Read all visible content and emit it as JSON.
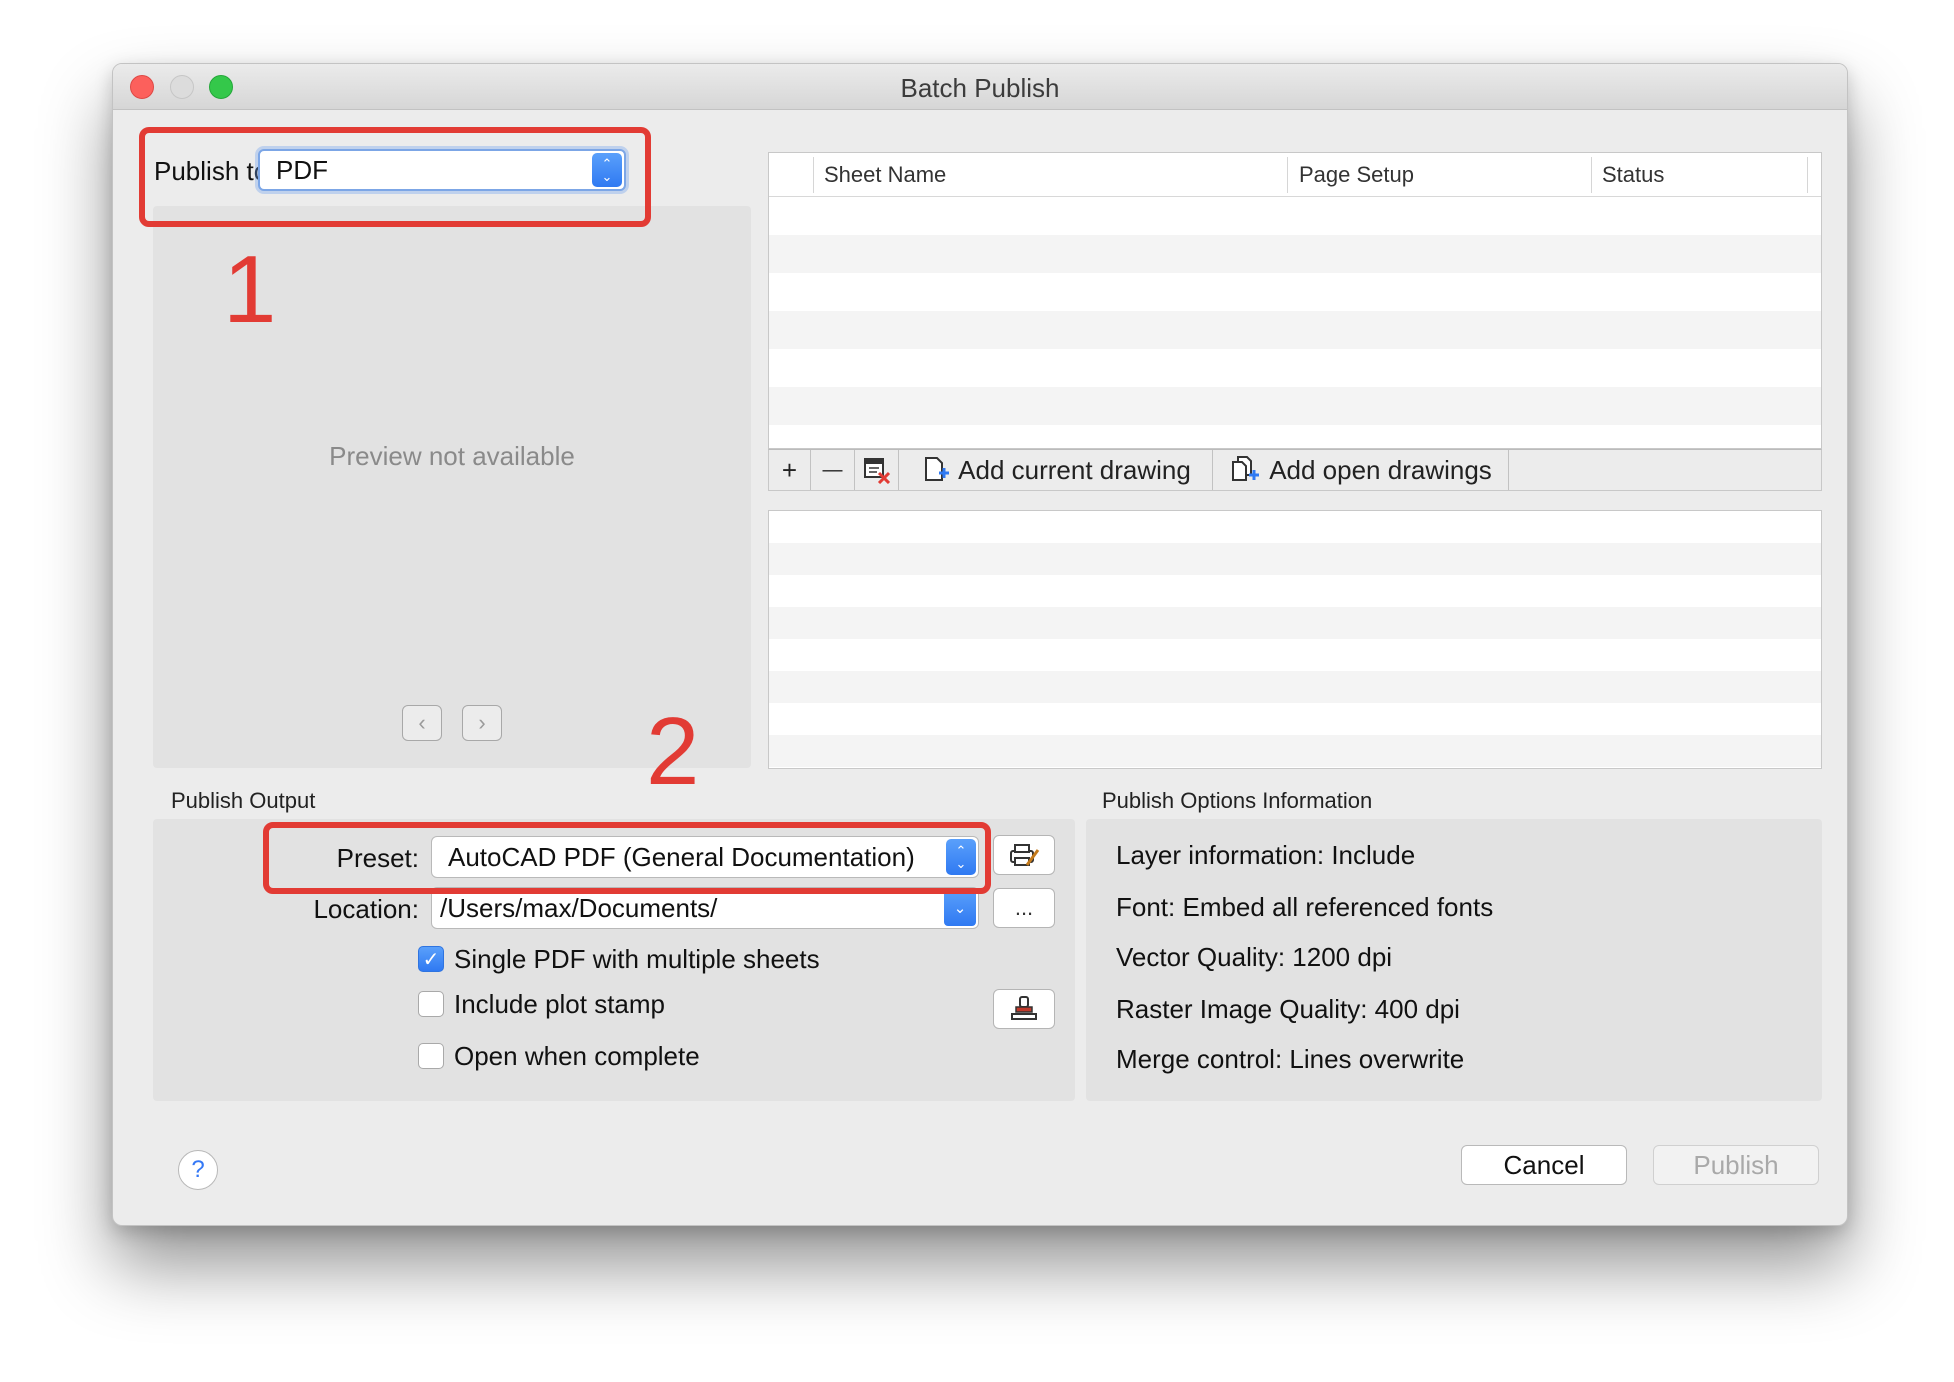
{
  "window": {
    "title": "Batch Publish"
  },
  "publish_to": {
    "label": "Publish to:",
    "value": "PDF"
  },
  "preview": {
    "message": "Preview not available",
    "prev_icon": "chevron-left-icon",
    "next_icon": "chevron-right-icon"
  },
  "sheet_table": {
    "columns": [
      "Sheet Name",
      "Page Setup",
      "Status"
    ],
    "rows": []
  },
  "toolbar": {
    "add_label": "+",
    "remove_label": "—",
    "add_current_label": "Add current drawing",
    "add_open_label": "Add open drawings"
  },
  "publish_output": {
    "section_label": "Publish Output",
    "preset_label": "Preset:",
    "preset_value": "AutoCAD PDF (General Documentation)",
    "location_label": "Location:",
    "location_value": "/Users/max/Documents/",
    "browse_label": "...",
    "single_pdf": {
      "label": "Single PDF with multiple sheets",
      "checked": true
    },
    "plot_stamp": {
      "label": "Include plot stamp",
      "checked": false
    },
    "open_complete": {
      "label": "Open when complete",
      "checked": false
    }
  },
  "publish_options": {
    "section_label": "Publish Options Information",
    "lines": [
      "Layer information:  Include",
      "Font:  Embed all referenced fonts",
      "Vector Quality:  1200 dpi",
      "Raster Image Quality:  400 dpi",
      "Merge control:  Lines overwrite"
    ]
  },
  "buttons": {
    "help": "?",
    "cancel": "Cancel",
    "publish": "Publish"
  },
  "annotations": {
    "one": "1",
    "two": "2",
    "color": "#e23b34"
  },
  "colors": {
    "accent": "#3478f6",
    "window_bg": "#ececec"
  }
}
